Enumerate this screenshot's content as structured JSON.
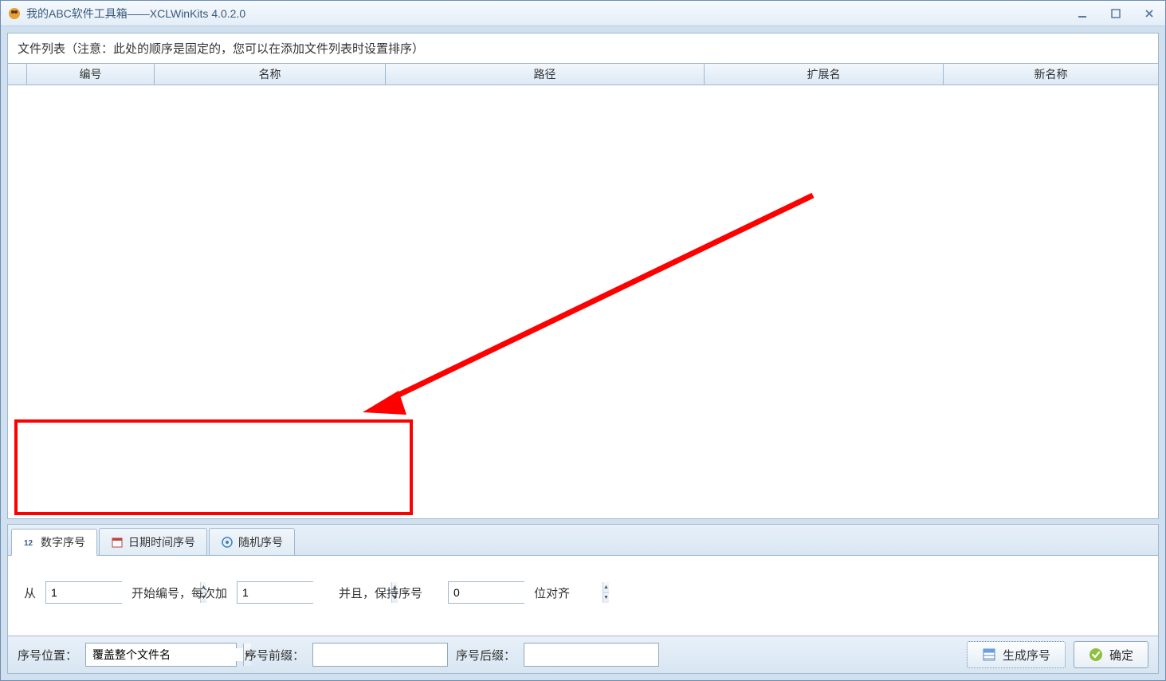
{
  "window": {
    "title": "我的ABC软件工具箱——XCLWinKits  4.0.2.0"
  },
  "fileList": {
    "note": "文件列表（注意：此处的顺序是固定的，您可以在添加文件列表时设置排序）",
    "columns": {
      "c1": "编号",
      "c2": "名称",
      "c3": "路径",
      "c4": "扩展名",
      "c5": "新名称"
    }
  },
  "tabs": {
    "t1": "数字序号",
    "t2": "日期时间序号",
    "t3": "随机序号"
  },
  "numericSeq": {
    "label_from": "从",
    "start_value": "1",
    "label_start": "开始编号，每次加",
    "step_value": "1",
    "label_keep": "并且，保持序号",
    "align_value": "0",
    "label_align": "位对齐"
  },
  "bottom": {
    "pos_label": "序号位置：",
    "pos_value": "覆盖整个文件名",
    "prefix_label": "序号前缀：",
    "prefix_value": "",
    "suffix_label": "序号后缀：",
    "suffix_value": "",
    "generate": "生成序号",
    "ok": "确定"
  }
}
